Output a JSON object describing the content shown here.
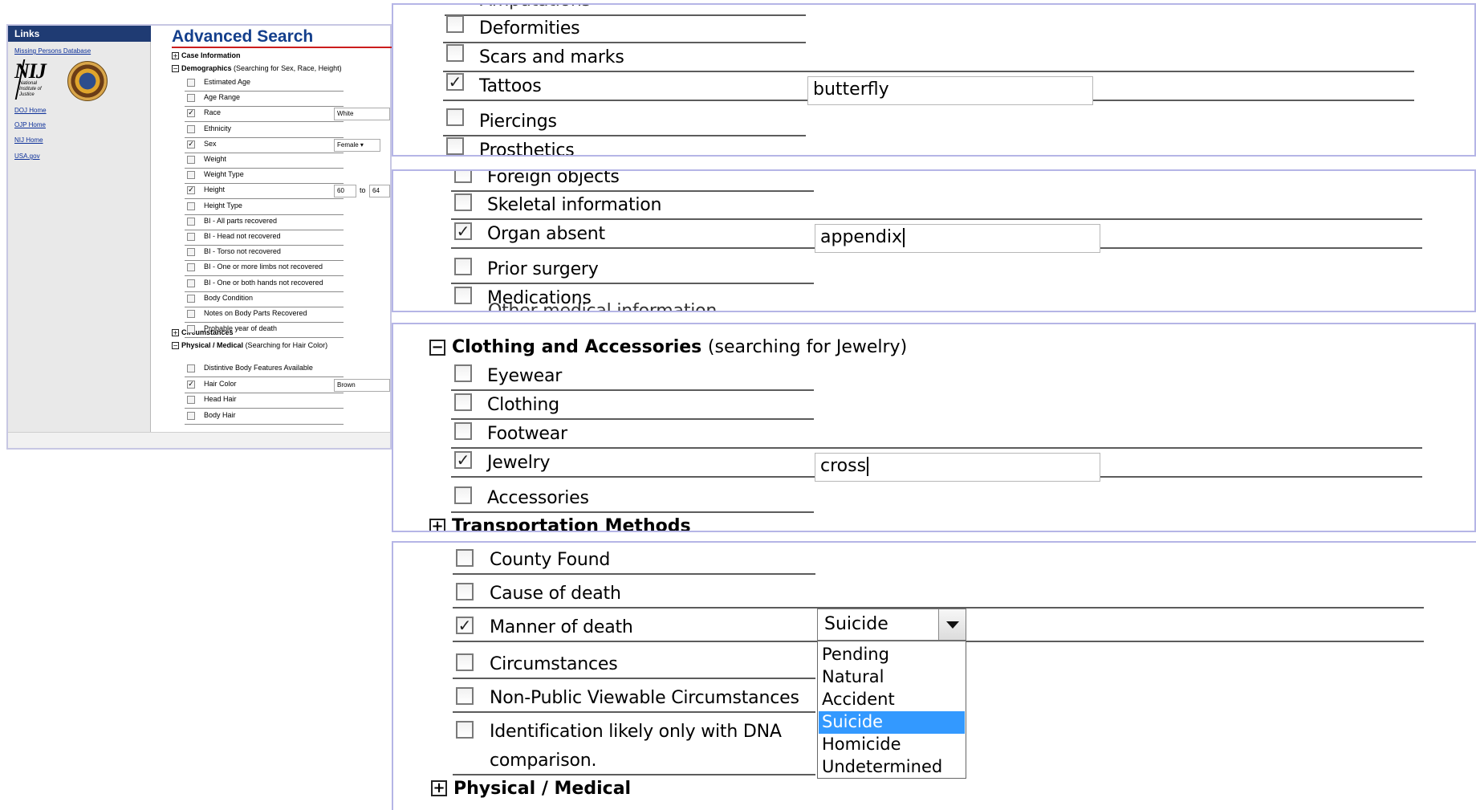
{
  "sidebar": {
    "title": "Links",
    "db_link": "Missing Persons Database",
    "logo_text": "NIJ",
    "logo_sub": "National Institute of Justice",
    "links": [
      "DOJ Home",
      "OJP Home",
      "NIJ Home",
      "USA.gov"
    ]
  },
  "page": {
    "title": "Advanced Search",
    "sections": {
      "case": "Case Information",
      "demo": "Demographics",
      "demo_note": "(Searching for Sex, Race, Height)",
      "circ": "Circumstances",
      "phys": "Physical / Medical",
      "phys_note": "(Searching for Hair Color)"
    },
    "demo_rows": [
      {
        "label": "Estimated Age",
        "checked": false
      },
      {
        "label": "Age Range",
        "checked": false
      },
      {
        "label": "Race",
        "checked": true,
        "value": "White"
      },
      {
        "label": "Ethnicity",
        "checked": false
      },
      {
        "label": "Sex",
        "checked": true,
        "value": "Female"
      },
      {
        "label": "Weight",
        "checked": false
      },
      {
        "label": "Weight Type",
        "checked": false
      },
      {
        "label": "Height",
        "checked": true,
        "value": "60",
        "to_label": "to",
        "value2": "64"
      },
      {
        "label": "Height Type",
        "checked": false
      },
      {
        "label": "BI - All parts recovered",
        "checked": false
      },
      {
        "label": "BI - Head not recovered",
        "checked": false
      },
      {
        "label": "BI - Torso not recovered",
        "checked": false
      },
      {
        "label": "BI - One or more limbs not recovered",
        "checked": false
      },
      {
        "label": "BI - One or both hands not recovered",
        "checked": false
      },
      {
        "label": "Body Condition",
        "checked": false
      },
      {
        "label": "Notes on Body Parts Recovered",
        "checked": false
      },
      {
        "label": "Probable year of death",
        "checked": false
      }
    ],
    "phys_rows": [
      {
        "label": "Distintive Body Features Available",
        "checked": false
      },
      {
        "label": "Hair Color",
        "checked": true,
        "value": "Brown"
      },
      {
        "label": "Head Hair",
        "checked": false
      },
      {
        "label": "Body Hair",
        "checked": false
      }
    ]
  },
  "panel1": {
    "top_cut": "Amputations",
    "rows": [
      {
        "label": "Deformities",
        "checked": false
      },
      {
        "label": "Scars and marks",
        "checked": false
      },
      {
        "label": "Tattoos",
        "checked": true,
        "value": "butterfly"
      },
      {
        "label": "Piercings",
        "checked": false
      },
      {
        "label": "Prosthetics",
        "checked": false
      }
    ]
  },
  "panel2": {
    "rows": [
      {
        "label": "Foreign objects",
        "checked": false
      },
      {
        "label": "Skeletal information",
        "checked": false
      },
      {
        "label": "Organ absent",
        "checked": true,
        "value": "appendix"
      },
      {
        "label": "Prior surgery",
        "checked": false
      },
      {
        "label": "Medications",
        "checked": false
      }
    ],
    "bottom_cut": "Other medical information"
  },
  "panel3": {
    "section": "Clothing and Accessories",
    "section_note": "(searching for Jewelry)",
    "rows": [
      {
        "label": "Eyewear",
        "checked": false
      },
      {
        "label": "Clothing",
        "checked": false
      },
      {
        "label": "Footwear",
        "checked": false
      },
      {
        "label": "Jewelry",
        "checked": true,
        "value": "cross"
      },
      {
        "label": "Accessories",
        "checked": false
      }
    ],
    "next_section": "Transportation Methods"
  },
  "panel4": {
    "rows": [
      {
        "label": "County Found",
        "checked": false
      },
      {
        "label": "Cause of death",
        "checked": false
      },
      {
        "label": "Manner of death",
        "checked": true
      },
      {
        "label": "Circumstances",
        "checked": false
      },
      {
        "label": "Non-Public Viewable Circumstances",
        "checked": false
      },
      {
        "label": "Identification likely only with DNA",
        "label2": "comparison.",
        "checked": false
      }
    ],
    "select_value": "Suicide",
    "options": [
      "Pending",
      "Natural",
      "Accident",
      "Suicide",
      "Homicide",
      "Undetermined"
    ],
    "selected_index": 3,
    "next_section": "Physical / Medical"
  },
  "colors": {
    "link_header": "#1f3b73",
    "title": "#143f8c",
    "title_rule": "#cc1d1d",
    "panel_border": "#b5b5e6",
    "option_highlight": "#3399ff"
  }
}
